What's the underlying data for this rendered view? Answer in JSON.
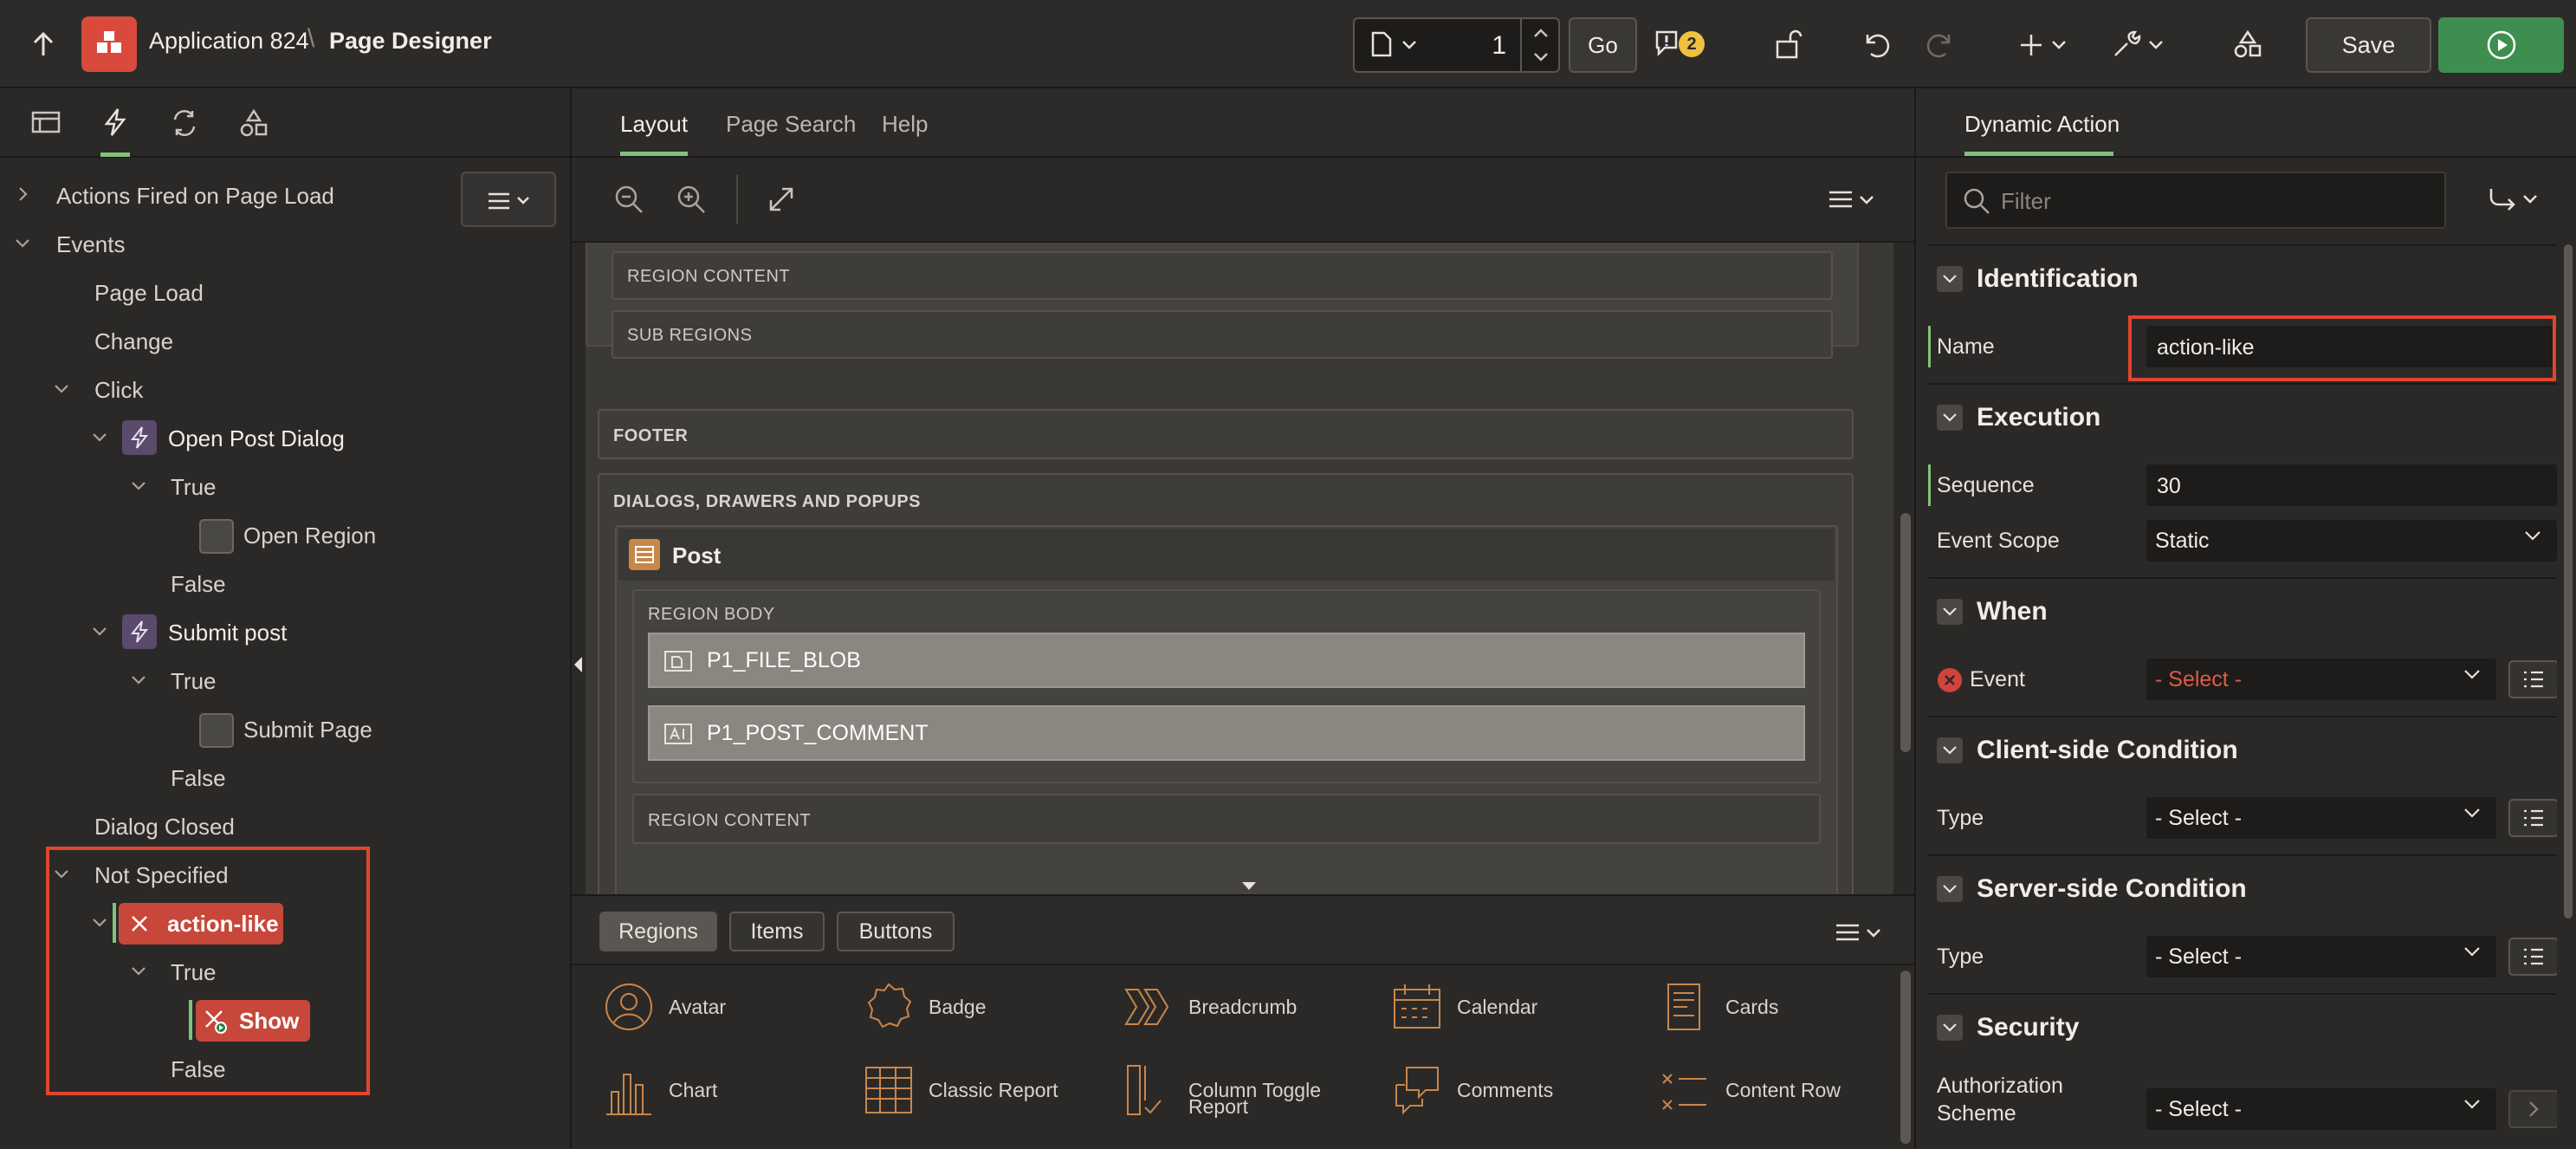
{
  "topbar": {
    "app_name": "Application 824",
    "separator": "\\",
    "page_title": "Page Designer",
    "page_number": "1",
    "go_label": "Go",
    "messages_count": "2",
    "save_label": "Save",
    "colors": {
      "accent": "#3e8f4f",
      "app_logo": "#d94a3c",
      "badge": "#f0c040"
    }
  },
  "left": {
    "tabs": [
      "rendering-icon",
      "dynamic-actions-icon",
      "processing-icon",
      "shared-components-icon"
    ],
    "tree": {
      "actions_fired": "Actions Fired on Page Load",
      "events": "Events",
      "page_load": "Page Load",
      "change": "Change",
      "click": "Click",
      "open_post_dialog": "Open Post Dialog",
      "true1": "True",
      "open_region": "Open Region",
      "false1": "False",
      "submit_post": "Submit post",
      "true2": "True",
      "submit_page": "Submit Page",
      "false2": "False",
      "dialog_closed": "Dialog Closed",
      "not_specified": "Not Specified",
      "action_like": "action-like",
      "true3": "True",
      "show": "Show",
      "false3": "False"
    }
  },
  "center": {
    "tabs": {
      "layout": "Layout",
      "page_search": "Page Search",
      "help": "Help"
    },
    "canvas": {
      "region_content_1": "REGION CONTENT",
      "sub_regions": "SUB REGIONS",
      "footer": "FOOTER",
      "dialogs": "DIALOGS, DRAWERS AND POPUPS",
      "post": "Post",
      "region_body": "REGION BODY",
      "item1": "P1_FILE_BLOB",
      "item2": "P1_POST_COMMENT",
      "region_content_2": "REGION CONTENT"
    },
    "gallery_tabs": {
      "regions": "Regions",
      "items": "Items",
      "buttons": "Buttons"
    },
    "gallery": {
      "avatar": "Avatar",
      "badge": "Badge",
      "breadcrumb": "Breadcrumb",
      "calendar": "Calendar",
      "cards": "Cards",
      "chart": "Chart",
      "classic_report": "Classic Report",
      "column_toggle_1": "Column Toggle",
      "column_toggle_2": "Report",
      "comments": "Comments",
      "content_row": "Content Row"
    }
  },
  "right": {
    "tab": "Dynamic Action",
    "filter_placeholder": "Filter",
    "groups": {
      "identification": "Identification",
      "execution": "Execution",
      "when": "When",
      "client_condition": "Client-side Condition",
      "server_condition": "Server-side Condition",
      "security": "Security"
    },
    "fields": {
      "name_label": "Name",
      "name_value": "action-like",
      "sequence_label": "Sequence",
      "sequence_value": "30",
      "event_scope_label": "Event Scope",
      "event_scope_value": "Static",
      "event_label": "Event",
      "event_value": "- Select -",
      "client_type_label": "Type",
      "client_type_value": "- Select -",
      "server_type_label": "Type",
      "server_type_value": "- Select -",
      "auth_label_1": "Authorization",
      "auth_label_2": "Scheme",
      "auth_value": "- Select -"
    }
  }
}
